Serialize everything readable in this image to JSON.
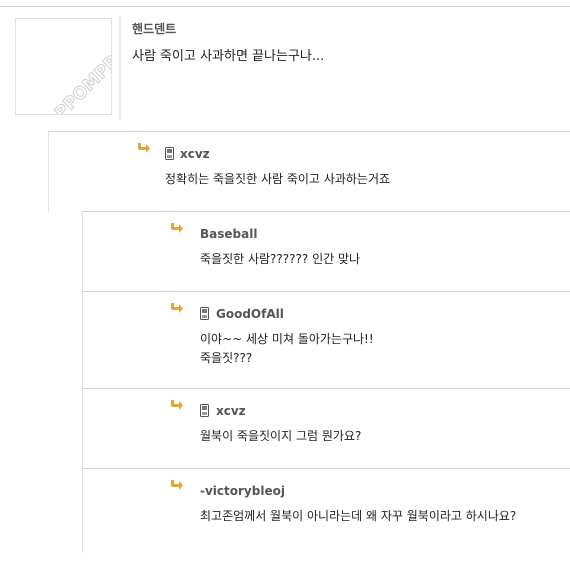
{
  "post": {
    "author": "핸드덴트",
    "text": "사람 죽이고 사과하면 끝나는구나...",
    "avatar_watermark": "PPOMPPU"
  },
  "replies": [
    {
      "author": "xcvz",
      "mobile": true,
      "text": "정확히는 죽을짓한 사람 죽이고 사과하는거죠"
    },
    {
      "author": "Baseball",
      "mobile": false,
      "text": "죽을짓한 사람?????? 인간 맞나"
    },
    {
      "author": "GoodOfAll",
      "mobile": true,
      "text": "이야~~ 세상 미쳐 돌아가는구나!!\n죽을짓???"
    },
    {
      "author": "xcvz",
      "mobile": true,
      "text": "월북이 죽을짓이지 그럼 뭔가요?"
    },
    {
      "author": "-victorybleoj",
      "mobile": false,
      "text": "최고존엄께서 월북이 아니라는데 왜 자꾸 월북이라고 하시나요?"
    }
  ],
  "icons": {
    "reply_arrow": "reply-arrow-icon",
    "mobile": "mobile-phone-icon"
  },
  "colors": {
    "reply_arrow": "#e8a33a",
    "divider": "#d4d4d4"
  }
}
